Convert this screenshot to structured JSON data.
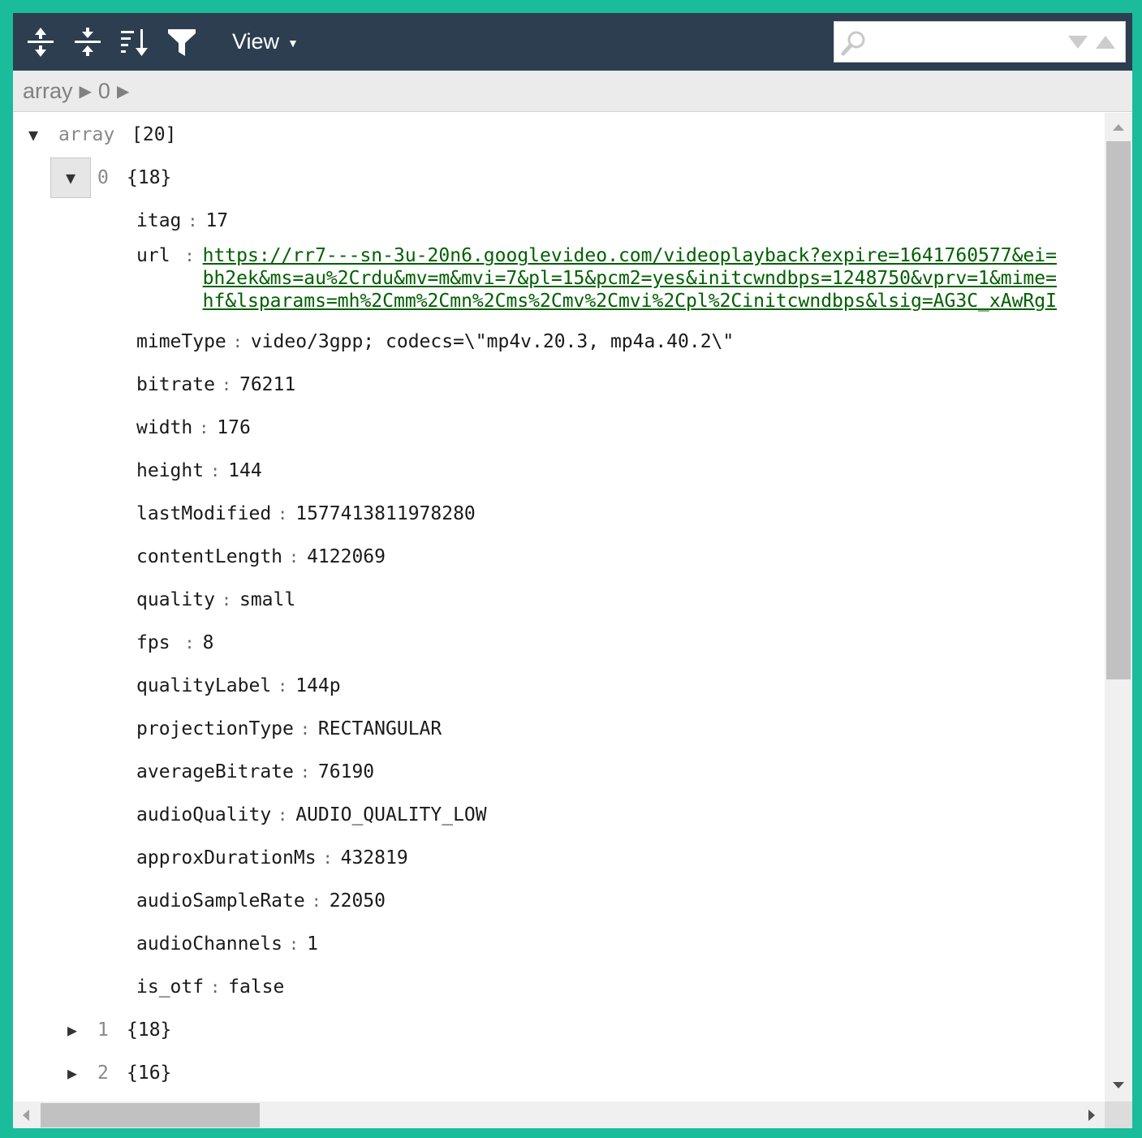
{
  "toolbar": {
    "buttons": [
      {
        "name": "expand-all",
        "icon": "expand-all-icon"
      },
      {
        "name": "collapse-all",
        "icon": "collapse-all-icon"
      },
      {
        "name": "sort",
        "icon": "sort-icon"
      },
      {
        "name": "filter",
        "icon": "filter-icon"
      }
    ],
    "view_label": "View",
    "search": {
      "value": "",
      "placeholder": ""
    }
  },
  "breadcrumb": {
    "items": [
      "array",
      "0"
    ]
  },
  "tree": {
    "root": {
      "key": "array",
      "count": "[20]"
    },
    "node0": {
      "key": "0",
      "count": "{18}"
    },
    "fields": [
      {
        "key": "itag",
        "value": "17"
      },
      {
        "key": "url",
        "value_lines": [
          "https://rr7---sn-3u-20n6.googlevideo.com/videoplayback?expire=1641760577&ei=",
          "bh2ek&ms=au%2Crdu&mv=m&mvi=7&pl=15&pcm2=yes&initcwndbps=1248750&vprv=1&mime=",
          "hf&lsparams=mh%2Cmm%2Cmn%2Cms%2Cmv%2Cmvi%2Cpl%2Cinitcwndbps&lsig=AG3C_xAwRgI"
        ]
      },
      {
        "key": "mimeType",
        "value": "video/3gpp; codecs=\\\"mp4v.20.3, mp4a.40.2\\\""
      },
      {
        "key": "bitrate",
        "value": "76211"
      },
      {
        "key": "width",
        "value": "176"
      },
      {
        "key": "height",
        "value": "144"
      },
      {
        "key": "lastModified",
        "value": "1577413811978280"
      },
      {
        "key": "contentLength",
        "value": "4122069"
      },
      {
        "key": "quality",
        "value": "small"
      },
      {
        "key": "fps",
        "value": "8"
      },
      {
        "key": "qualityLabel",
        "value": "144p"
      },
      {
        "key": "projectionType",
        "value": "RECTANGULAR"
      },
      {
        "key": "averageBitrate",
        "value": "76190"
      },
      {
        "key": "audioQuality",
        "value": "AUDIO_QUALITY_LOW"
      },
      {
        "key": "approxDurationMs",
        "value": "432819"
      },
      {
        "key": "audioSampleRate",
        "value": "22050"
      },
      {
        "key": "audioChannels",
        "value": "1"
      },
      {
        "key": "is_otf",
        "value": "false"
      }
    ],
    "siblings": [
      {
        "key": "1",
        "count": "{18}"
      },
      {
        "key": "2",
        "count": "{16}"
      }
    ]
  },
  "colors": {
    "frame": "#1abc9c",
    "toolbar": "#2c3e50",
    "url": "#006000"
  }
}
